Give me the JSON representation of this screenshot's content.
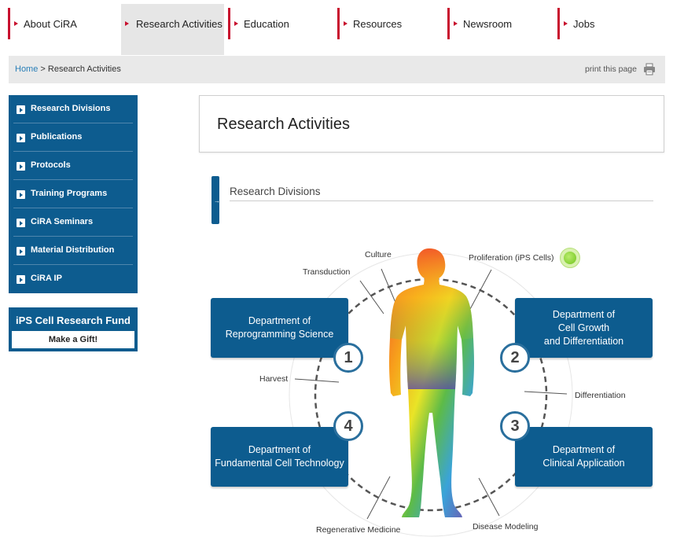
{
  "nav": {
    "items": [
      {
        "label": "About CiRA"
      },
      {
        "label": "Research Activities"
      },
      {
        "label": "Education"
      },
      {
        "label": "Resources"
      },
      {
        "label": "Newsroom"
      },
      {
        "label": "Jobs"
      }
    ],
    "active_index": 1
  },
  "breadcrumb": {
    "home": "Home",
    "separator": " > ",
    "current": "Research Activities",
    "print_label": "print this page"
  },
  "sidebar": {
    "items": [
      {
        "label": "Research Divisions"
      },
      {
        "label": "Publications"
      },
      {
        "label": "Protocols"
      },
      {
        "label": "Training Programs"
      },
      {
        "label": "CiRA Seminars"
      },
      {
        "label": "Material Distribution"
      },
      {
        "label": "CiRA IP"
      }
    ],
    "fund_title": "iPS Cell Research Fund",
    "fund_cta": "Make a Gift!"
  },
  "main": {
    "title": "Research Activities",
    "section_title": "Research Divisions"
  },
  "diagram": {
    "departments": [
      {
        "number": "1",
        "lines": [
          "Department of",
          "Reprogramming Science"
        ]
      },
      {
        "number": "2",
        "lines": [
          "Department of",
          "Cell Growth",
          "and Differentiation"
        ]
      },
      {
        "number": "3",
        "lines": [
          "Department of",
          "Clinical Application"
        ]
      },
      {
        "number": "4",
        "lines": [
          "Department of",
          "Fundamental Cell Technology"
        ]
      }
    ],
    "labels": {
      "culture": "Culture",
      "transduction": "Transduction",
      "proliferation": "Proliferation (iPS Cells)",
      "harvest": "Harvest",
      "differentiation": "Differentiation",
      "regenerative": "Regenerative Medicine",
      "disease": "Disease Modeling"
    }
  },
  "colors": {
    "brand_blue": "#0d5c8f",
    "nav_accent_red": "#c8102e",
    "link_blue": "#2a7fb8"
  }
}
